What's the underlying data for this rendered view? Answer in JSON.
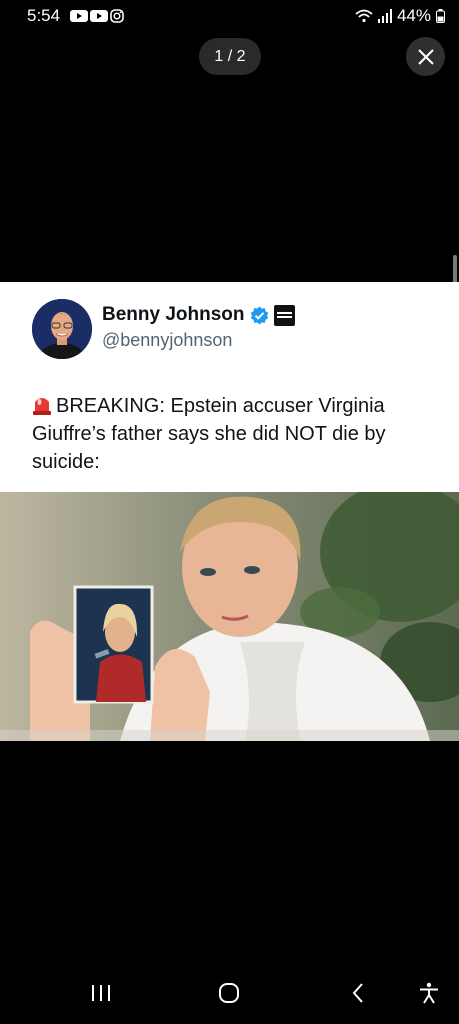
{
  "status_bar": {
    "time": "5:54",
    "battery": "44%",
    "notifications": [
      "youtube-icon",
      "youtube-icon",
      "instagram-icon"
    ],
    "icons": [
      "wifi-icon",
      "signal-icon",
      "battery-icon"
    ]
  },
  "viewer": {
    "page_indicator": "1 / 2"
  },
  "tweet": {
    "author_name": "Benny Johnson",
    "author_handle": "@bennyjohnson",
    "verified": true,
    "breaking_label": "BREAKING:",
    "body": "Epstein accuser Virginia Giuffre’s father says she did NOT die by suicide:"
  },
  "nav_bar": {
    "buttons": [
      "recent-apps",
      "home",
      "back",
      "accessibility"
    ]
  },
  "colors": {
    "background": "#000000",
    "card": "#ffffff",
    "verified_blue": "#1d9bf0",
    "text": "#0f1419",
    "muted": "#536471"
  }
}
